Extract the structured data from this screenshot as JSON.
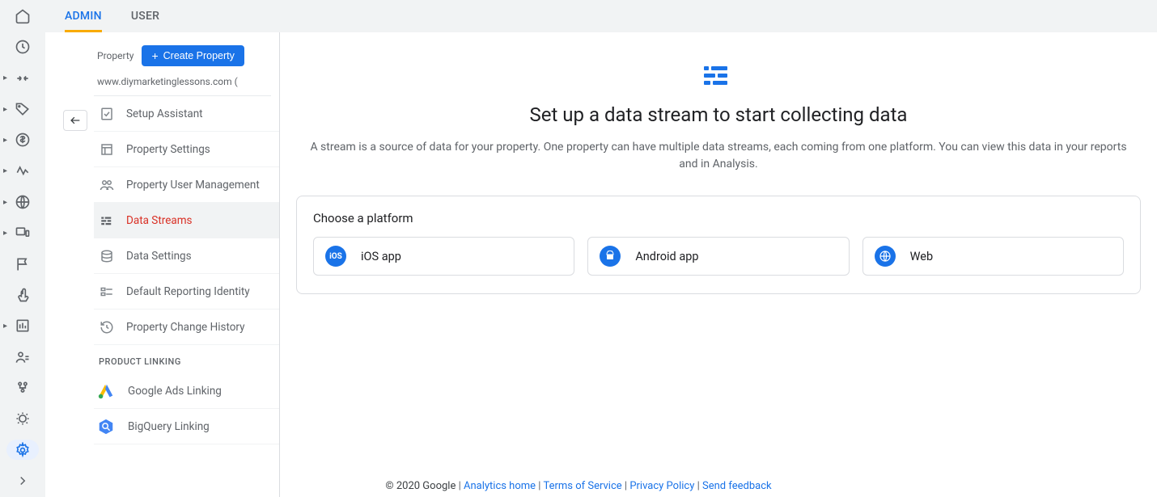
{
  "tabs": {
    "admin": "ADMIN",
    "user": "USER"
  },
  "sidebar": {
    "property_label": "Property",
    "create_btn": "Create Property",
    "property_name": "www.diymarketinglessons.com (",
    "items": [
      {
        "label": "Setup Assistant"
      },
      {
        "label": "Property Settings"
      },
      {
        "label": "Property User Management"
      },
      {
        "label": "Data Streams"
      },
      {
        "label": "Data Settings"
      },
      {
        "label": "Default Reporting Identity"
      },
      {
        "label": "Property Change History"
      }
    ],
    "section": "PRODUCT LINKING",
    "links": [
      {
        "label": "Google Ads Linking"
      },
      {
        "label": "BigQuery Linking"
      }
    ]
  },
  "main": {
    "title": "Set up a data stream to start collecting data",
    "subtitle": "A stream is a source of data for your property. One property can have multiple data streams, each coming from one platform. You can view this data in your reports and in Analysis.",
    "choose_label": "Choose a platform",
    "platforms": {
      "ios": "iOS app",
      "android": "Android app",
      "web": "Web"
    }
  },
  "footer": {
    "copyright": "© 2020 Google",
    "links": {
      "home": "Analytics home",
      "tos": "Terms of Service",
      "privacy": "Privacy Policy",
      "feedback": "Send feedback"
    }
  }
}
